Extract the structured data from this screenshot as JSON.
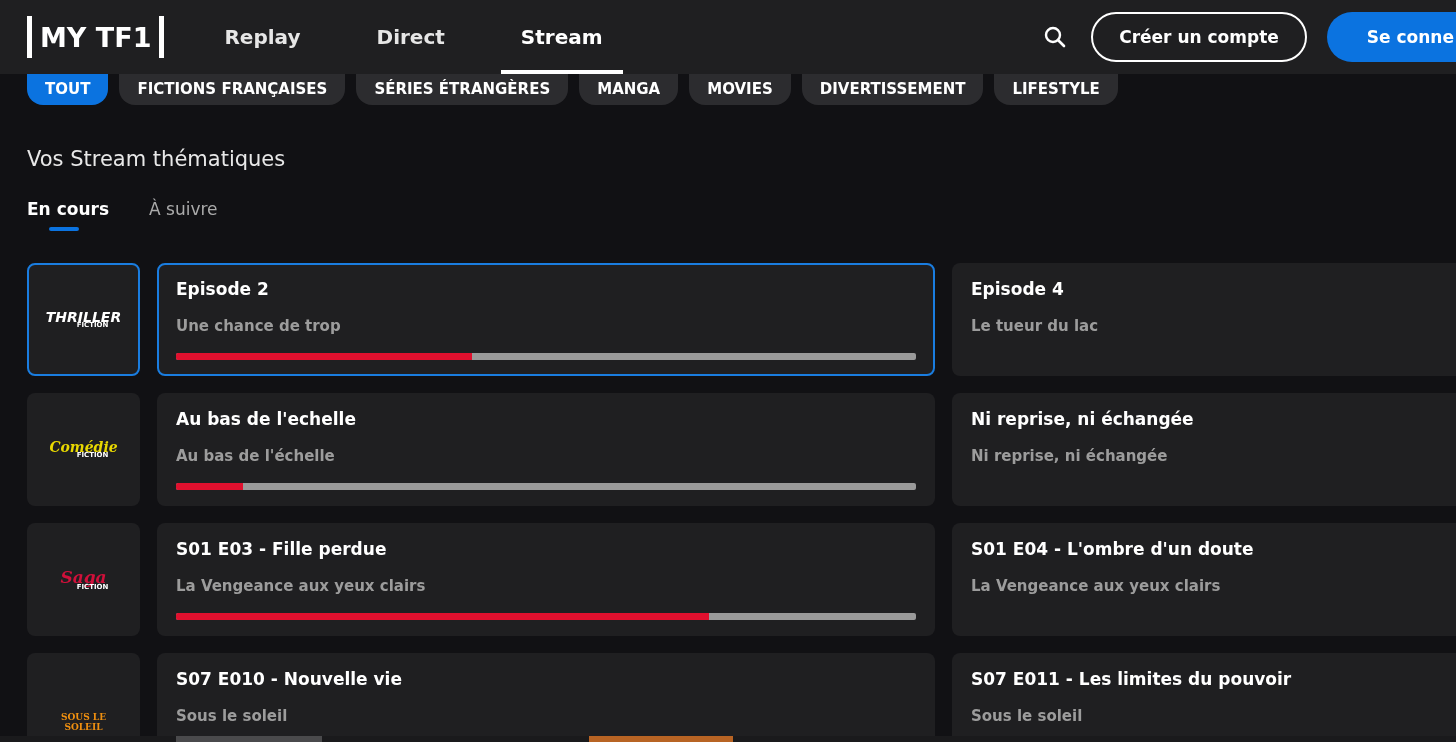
{
  "header": {
    "logo": "MY TF1",
    "nav": [
      {
        "label": "Replay",
        "selected": false
      },
      {
        "label": "Direct",
        "selected": false
      },
      {
        "label": "Stream",
        "selected": true
      }
    ],
    "buttons": [
      {
        "kind": "outline",
        "label": "Créer un compte"
      },
      {
        "kind": "primary",
        "label": "Se conne"
      }
    ]
  },
  "categories": [
    {
      "label": "TOUT",
      "selected": true
    },
    {
      "label": "FICTIONS FRANÇAISES",
      "selected": false
    },
    {
      "label": "SÉRIES ÉTRANGÈRES",
      "selected": false
    },
    {
      "label": "MANGA",
      "selected": false
    },
    {
      "label": "MOVIES",
      "selected": false
    },
    {
      "label": "DIVERTISSEMENT",
      "selected": false
    },
    {
      "label": "LIFESTYLE",
      "selected": false
    }
  ],
  "section_title": "Vos Stream thématiques",
  "tabs": [
    {
      "label": "En cours",
      "selected": true
    },
    {
      "label": "À suivre",
      "selected": false
    }
  ],
  "rows": [
    {
      "selected": true,
      "channel": {
        "kind": "thriller",
        "name": "THRILLER",
        "sub": "FICTION"
      },
      "current": {
        "title": "Episode 2",
        "subtitle": "Une chance de trop",
        "level": 0.4
      },
      "next": {
        "title": "Episode 4",
        "subtitle": "Le tueur du lac"
      }
    },
    {
      "selected": false,
      "channel": {
        "kind": "comedie",
        "name": "Comédie",
        "sub": "FICTION"
      },
      "current": {
        "title": "Au bas de l'echelle",
        "subtitle": "Au bas de l'échelle",
        "level": 0.09
      },
      "next": {
        "title": "Ni reprise, ni échangée",
        "subtitle": "Ni reprise, ni échangée"
      }
    },
    {
      "selected": false,
      "channel": {
        "kind": "saga",
        "name": "Saga",
        "sub": "FICTION"
      },
      "current": {
        "title": "S01 E03 - Fille perdue",
        "subtitle": "La Vengeance aux yeux clairs",
        "level": 0.72
      },
      "next": {
        "title": "S01 E04 - L'ombre d'un doute",
        "subtitle": "La Vengeance aux yeux clairs"
      }
    },
    {
      "selected": false,
      "channel": {
        "kind": "soleil",
        "name": "SOUS LE SOLEIL"
      },
      "current": {
        "title": "S07 E010 - Nouvelle vie",
        "subtitle": "Sous le soleil"
      },
      "next": {
        "title": "S07 E011 - Les limites du pouvoir",
        "subtitle": "Sous le soleil"
      }
    }
  ]
}
